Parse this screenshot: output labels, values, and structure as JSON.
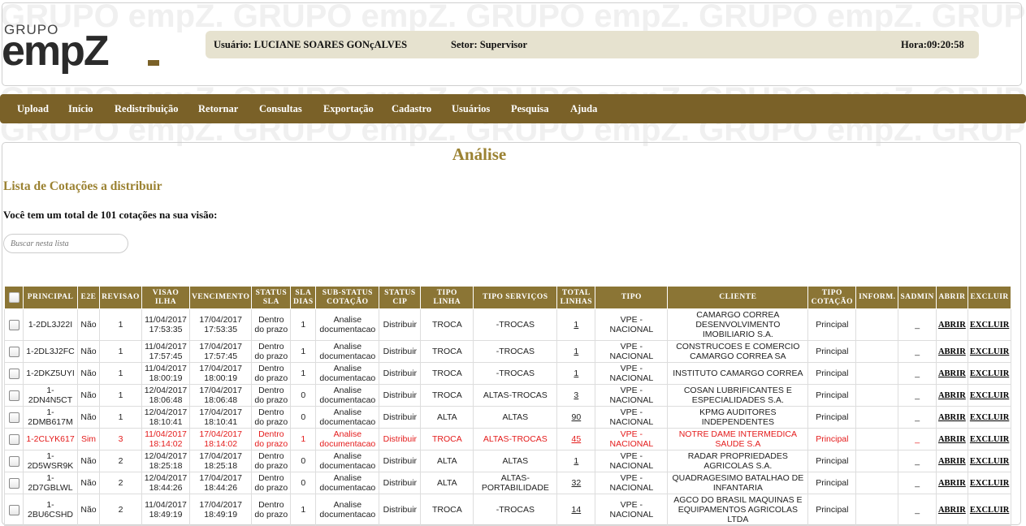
{
  "logo": {
    "top_text": "GRUPO",
    "word": "empZ",
    "watermark": "GRUPO empZ."
  },
  "userbar": {
    "user": "Usuário: LUCIANE SOARES GONçALVES",
    "sector": "Setor: Supervisor",
    "time": "Hora:09:20:58"
  },
  "nav": [
    "Upload",
    "Início",
    "Redistribuição",
    "Retornar",
    "Consultas",
    "Exportação",
    "Cadastro",
    "Usuários",
    "Pesquisa",
    "Ajuda"
  ],
  "page_title": "Análise",
  "list_title": "Lista de Cotações a distribuir",
  "total_line": "Você tem um total de 101 cotações na sua visão:",
  "search": {
    "placeholder": "Buscar nesta lista"
  },
  "columns": [
    [
      "PRINCIPAL"
    ],
    [
      "E2E"
    ],
    [
      "REVISAO"
    ],
    [
      "VISAO",
      "ILHA"
    ],
    [
      "VENCIMENTO"
    ],
    [
      "STATUS",
      "SLA"
    ],
    [
      "SLA",
      "DIAS"
    ],
    [
      "SUB-STATUS",
      "COTAÇÃO"
    ],
    [
      "STATUS",
      "CIP"
    ],
    [
      "TIPO",
      "LINHA"
    ],
    [
      "TIPO SERVIÇOS"
    ],
    [
      "TOTAL",
      "LINHAS"
    ],
    [
      "TIPO"
    ],
    [
      "CLIENTE"
    ],
    [
      "TIPO",
      "COTAÇÃO"
    ],
    [
      "INFORM."
    ],
    [
      "SADMIN"
    ],
    [
      "ABRIR"
    ],
    [
      "EXCLUIR"
    ]
  ],
  "rows": [
    {
      "principal": [
        "1-2DL3J22I"
      ],
      "e2e": "Não",
      "rev": "1",
      "visao": [
        "11/04/2017",
        "17:53:35"
      ],
      "venc": [
        "17/04/2017",
        "17:53:35"
      ],
      "status_sla": [
        "Dentro",
        "do prazo"
      ],
      "sla_dias": "1",
      "sub_status": [
        "Analise",
        "documentacao"
      ],
      "status_cip": "Distribuir",
      "tipo_linha": "TROCA",
      "tipo_servicos": [
        "-TROCAS"
      ],
      "total": "1",
      "tipo": "VPE - NACIONAL",
      "cliente": [
        "CAMARGO CORREA",
        "DESENVOLVIMENTO",
        "IMOBILIARIO S.A."
      ],
      "tipo_cotacao": "Principal",
      "inform": "",
      "sadmin": "_",
      "abrir": "ABRIR",
      "excluir": "EXCLUIR"
    },
    {
      "principal": [
        "1-2DL3J2FC"
      ],
      "e2e": "Não",
      "rev": "1",
      "visao": [
        "11/04/2017",
        "17:57:45"
      ],
      "venc": [
        "17/04/2017",
        "17:57:45"
      ],
      "status_sla": [
        "Dentro",
        "do prazo"
      ],
      "sla_dias": "1",
      "sub_status": [
        "Analise",
        "documentacao"
      ],
      "status_cip": "Distribuir",
      "tipo_linha": "TROCA",
      "tipo_servicos": [
        "-TROCAS"
      ],
      "total": "1",
      "tipo": "VPE - NACIONAL",
      "cliente": [
        "CONSTRUCOES E COMERCIO",
        "CAMARGO CORREA SA"
      ],
      "tipo_cotacao": "Principal",
      "inform": "",
      "sadmin": "_",
      "abrir": "ABRIR",
      "excluir": "EXCLUIR"
    },
    {
      "principal": [
        "1-2DKZ5UYI"
      ],
      "e2e": "Não",
      "rev": "1",
      "visao": [
        "11/04/2017",
        "18:00:19"
      ],
      "venc": [
        "17/04/2017",
        "18:00:19"
      ],
      "status_sla": [
        "Dentro",
        "do prazo"
      ],
      "sla_dias": "1",
      "sub_status": [
        "Analise",
        "documentacao"
      ],
      "status_cip": "Distribuir",
      "tipo_linha": "TROCA",
      "tipo_servicos": [
        "-TROCAS"
      ],
      "total": "1",
      "tipo": "VPE - NACIONAL",
      "cliente": [
        "INSTITUTO CAMARGO CORREA"
      ],
      "tipo_cotacao": "Principal",
      "inform": "",
      "sadmin": "_",
      "abrir": "ABRIR",
      "excluir": "EXCLUIR"
    },
    {
      "principal": [
        "1-2DN4N5CT"
      ],
      "e2e": "Não",
      "rev": "1",
      "visao": [
        "12/04/2017",
        "18:06:48"
      ],
      "venc": [
        "17/04/2017",
        "18:06:48"
      ],
      "status_sla": [
        "Dentro",
        "do prazo"
      ],
      "sla_dias": "0",
      "sub_status": [
        "Analise",
        "documentacao"
      ],
      "status_cip": "Distribuir",
      "tipo_linha": "TROCA",
      "tipo_servicos": [
        "ALTAS-TROCAS"
      ],
      "total": "3",
      "tipo": "VPE - NACIONAL",
      "cliente": [
        "COSAN LUBRIFICANTES E",
        "ESPECIALIDADES S.A."
      ],
      "tipo_cotacao": "Principal",
      "inform": "",
      "sadmin": "_",
      "abrir": "ABRIR",
      "excluir": "EXCLUIR"
    },
    {
      "principal": [
        "1-",
        "2DMB617M"
      ],
      "e2e": "Não",
      "rev": "1",
      "visao": [
        "12/04/2017",
        "18:10:41"
      ],
      "venc": [
        "17/04/2017",
        "18:10:41"
      ],
      "status_sla": [
        "Dentro",
        "do prazo"
      ],
      "sla_dias": "0",
      "sub_status": [
        "Analise",
        "documentacao"
      ],
      "status_cip": "Distribuir",
      "tipo_linha": "ALTA",
      "tipo_servicos": [
        "ALTAS"
      ],
      "total": "90",
      "tipo": "VPE - NACIONAL",
      "cliente": [
        "KPMG AUDITORES",
        "INDEPENDENTES"
      ],
      "tipo_cotacao": "Principal",
      "inform": "",
      "sadmin": "_",
      "abrir": "ABRIR",
      "excluir": "EXCLUIR"
    },
    {
      "principal": [
        "1-2CLYK617"
      ],
      "e2e": "Sim",
      "rev": "3",
      "visao": [
        "11/04/2017",
        "18:14:02"
      ],
      "venc": [
        "17/04/2017",
        "18:14:02"
      ],
      "status_sla": [
        "Dentro",
        "do prazo"
      ],
      "sla_dias": "1",
      "sub_status": [
        "Analise",
        "documentacao"
      ],
      "status_cip": "Distribuir",
      "tipo_linha": "TROCA",
      "tipo_servicos": [
        "ALTAS-TROCAS"
      ],
      "total": "45",
      "tipo": "VPE - NACIONAL",
      "cliente": [
        "NOTRE DAME INTERMEDICA",
        "SAUDE S.A"
      ],
      "tipo_cotacao": "Principal",
      "inform": "",
      "sadmin": "_",
      "abrir": "ABRIR",
      "excluir": "EXCLUIR",
      "highlight": true
    },
    {
      "principal": [
        "1-",
        "2D5WSR9K"
      ],
      "e2e": "Não",
      "rev": "2",
      "visao": [
        "12/04/2017",
        "18:25:18"
      ],
      "venc": [
        "17/04/2017",
        "18:25:18"
      ],
      "status_sla": [
        "Dentro",
        "do prazo"
      ],
      "sla_dias": "0",
      "sub_status": [
        "Analise",
        "documentacao"
      ],
      "status_cip": "Distribuir",
      "tipo_linha": "ALTA",
      "tipo_servicos": [
        "ALTAS"
      ],
      "total": "1",
      "tipo": "VPE - NACIONAL",
      "cliente": [
        "RADAR PROPRIEDADES",
        "AGRICOLAS S.A."
      ],
      "tipo_cotacao": "Principal",
      "inform": "",
      "sadmin": "_",
      "abrir": "ABRIR",
      "excluir": "EXCLUIR"
    },
    {
      "principal": [
        "1-",
        "2D7GBLWL"
      ],
      "e2e": "Não",
      "rev": "2",
      "visao": [
        "12/04/2017",
        "18:44:26"
      ],
      "venc": [
        "17/04/2017",
        "18:44:26"
      ],
      "status_sla": [
        "Dentro",
        "do prazo"
      ],
      "sla_dias": "0",
      "sub_status": [
        "Analise",
        "documentacao"
      ],
      "status_cip": "Distribuir",
      "tipo_linha": "ALTA",
      "tipo_servicos": [
        "ALTAS-",
        "PORTABILIDADE"
      ],
      "total": "32",
      "tipo": "VPE - NACIONAL",
      "cliente": [
        "QUADRAGESIMO BATALHAO DE",
        "INFANTARIA"
      ],
      "tipo_cotacao": "Principal",
      "inform": "",
      "sadmin": "_",
      "abrir": "ABRIR",
      "excluir": "EXCLUIR"
    },
    {
      "principal": [
        "1-",
        "2BU6CSHD"
      ],
      "e2e": "Não",
      "rev": "2",
      "visao": [
        "11/04/2017",
        "18:49:19"
      ],
      "venc": [
        "17/04/2017",
        "18:49:19"
      ],
      "status_sla": [
        "Dentro",
        "do prazo"
      ],
      "sla_dias": "1",
      "sub_status": [
        "Analise",
        "documentacao"
      ],
      "status_cip": "Distribuir",
      "tipo_linha": "TROCA",
      "tipo_servicos": [
        "-TROCAS"
      ],
      "total": "14",
      "tipo": "VPE - NACIONAL",
      "cliente": [
        "AGCO DO BRASIL MAQUINAS E",
        "EQUIPAMENTOS AGRICOLAS",
        "LTDA"
      ],
      "tipo_cotacao": "Principal",
      "inform": "",
      "sadmin": "_",
      "abrir": "ABRIR",
      "excluir": "EXCLUIR"
    }
  ]
}
